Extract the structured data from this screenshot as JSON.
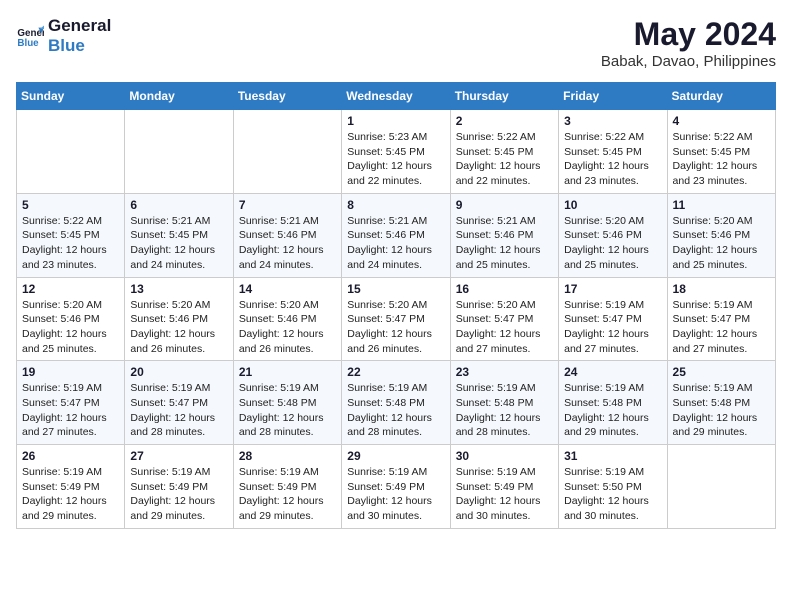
{
  "logo": {
    "line1": "General",
    "line2": "Blue"
  },
  "title": {
    "month_year": "May 2024",
    "location": "Babak, Davao, Philippines"
  },
  "weekdays": [
    "Sunday",
    "Monday",
    "Tuesday",
    "Wednesday",
    "Thursday",
    "Friday",
    "Saturday"
  ],
  "weeks": [
    [
      {
        "day": "",
        "info": ""
      },
      {
        "day": "",
        "info": ""
      },
      {
        "day": "",
        "info": ""
      },
      {
        "day": "1",
        "info": "Sunrise: 5:23 AM\nSunset: 5:45 PM\nDaylight: 12 hours\nand 22 minutes."
      },
      {
        "day": "2",
        "info": "Sunrise: 5:22 AM\nSunset: 5:45 PM\nDaylight: 12 hours\nand 22 minutes."
      },
      {
        "day": "3",
        "info": "Sunrise: 5:22 AM\nSunset: 5:45 PM\nDaylight: 12 hours\nand 23 minutes."
      },
      {
        "day": "4",
        "info": "Sunrise: 5:22 AM\nSunset: 5:45 PM\nDaylight: 12 hours\nand 23 minutes."
      }
    ],
    [
      {
        "day": "5",
        "info": "Sunrise: 5:22 AM\nSunset: 5:45 PM\nDaylight: 12 hours\nand 23 minutes."
      },
      {
        "day": "6",
        "info": "Sunrise: 5:21 AM\nSunset: 5:45 PM\nDaylight: 12 hours\nand 24 minutes."
      },
      {
        "day": "7",
        "info": "Sunrise: 5:21 AM\nSunset: 5:46 PM\nDaylight: 12 hours\nand 24 minutes."
      },
      {
        "day": "8",
        "info": "Sunrise: 5:21 AM\nSunset: 5:46 PM\nDaylight: 12 hours\nand 24 minutes."
      },
      {
        "day": "9",
        "info": "Sunrise: 5:21 AM\nSunset: 5:46 PM\nDaylight: 12 hours\nand 25 minutes."
      },
      {
        "day": "10",
        "info": "Sunrise: 5:20 AM\nSunset: 5:46 PM\nDaylight: 12 hours\nand 25 minutes."
      },
      {
        "day": "11",
        "info": "Sunrise: 5:20 AM\nSunset: 5:46 PM\nDaylight: 12 hours\nand 25 minutes."
      }
    ],
    [
      {
        "day": "12",
        "info": "Sunrise: 5:20 AM\nSunset: 5:46 PM\nDaylight: 12 hours\nand 25 minutes."
      },
      {
        "day": "13",
        "info": "Sunrise: 5:20 AM\nSunset: 5:46 PM\nDaylight: 12 hours\nand 26 minutes."
      },
      {
        "day": "14",
        "info": "Sunrise: 5:20 AM\nSunset: 5:46 PM\nDaylight: 12 hours\nand 26 minutes."
      },
      {
        "day": "15",
        "info": "Sunrise: 5:20 AM\nSunset: 5:47 PM\nDaylight: 12 hours\nand 26 minutes."
      },
      {
        "day": "16",
        "info": "Sunrise: 5:20 AM\nSunset: 5:47 PM\nDaylight: 12 hours\nand 27 minutes."
      },
      {
        "day": "17",
        "info": "Sunrise: 5:19 AM\nSunset: 5:47 PM\nDaylight: 12 hours\nand 27 minutes."
      },
      {
        "day": "18",
        "info": "Sunrise: 5:19 AM\nSunset: 5:47 PM\nDaylight: 12 hours\nand 27 minutes."
      }
    ],
    [
      {
        "day": "19",
        "info": "Sunrise: 5:19 AM\nSunset: 5:47 PM\nDaylight: 12 hours\nand 27 minutes."
      },
      {
        "day": "20",
        "info": "Sunrise: 5:19 AM\nSunset: 5:47 PM\nDaylight: 12 hours\nand 28 minutes."
      },
      {
        "day": "21",
        "info": "Sunrise: 5:19 AM\nSunset: 5:48 PM\nDaylight: 12 hours\nand 28 minutes."
      },
      {
        "day": "22",
        "info": "Sunrise: 5:19 AM\nSunset: 5:48 PM\nDaylight: 12 hours\nand 28 minutes."
      },
      {
        "day": "23",
        "info": "Sunrise: 5:19 AM\nSunset: 5:48 PM\nDaylight: 12 hours\nand 28 minutes."
      },
      {
        "day": "24",
        "info": "Sunrise: 5:19 AM\nSunset: 5:48 PM\nDaylight: 12 hours\nand 29 minutes."
      },
      {
        "day": "25",
        "info": "Sunrise: 5:19 AM\nSunset: 5:48 PM\nDaylight: 12 hours\nand 29 minutes."
      }
    ],
    [
      {
        "day": "26",
        "info": "Sunrise: 5:19 AM\nSunset: 5:49 PM\nDaylight: 12 hours\nand 29 minutes."
      },
      {
        "day": "27",
        "info": "Sunrise: 5:19 AM\nSunset: 5:49 PM\nDaylight: 12 hours\nand 29 minutes."
      },
      {
        "day": "28",
        "info": "Sunrise: 5:19 AM\nSunset: 5:49 PM\nDaylight: 12 hours\nand 29 minutes."
      },
      {
        "day": "29",
        "info": "Sunrise: 5:19 AM\nSunset: 5:49 PM\nDaylight: 12 hours\nand 30 minutes."
      },
      {
        "day": "30",
        "info": "Sunrise: 5:19 AM\nSunset: 5:49 PM\nDaylight: 12 hours\nand 30 minutes."
      },
      {
        "day": "31",
        "info": "Sunrise: 5:19 AM\nSunset: 5:50 PM\nDaylight: 12 hours\nand 30 minutes."
      },
      {
        "day": "",
        "info": ""
      }
    ]
  ]
}
